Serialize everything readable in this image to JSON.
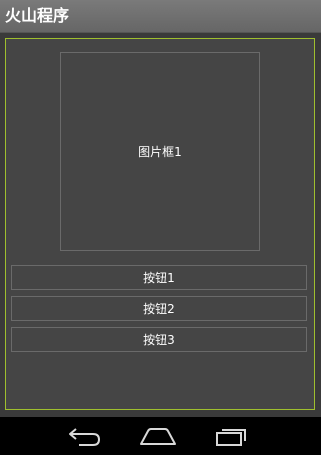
{
  "app": {
    "title": "火山程序"
  },
  "main": {
    "image_box_label": "图片框1",
    "buttons": [
      {
        "label": "按钮1"
      },
      {
        "label": "按钮2"
      },
      {
        "label": "按钮3"
      }
    ]
  },
  "nav": {
    "icons": [
      "back-icon",
      "home-icon",
      "recent-apps-icon"
    ]
  },
  "colors": {
    "title_bar": "#6f6f6f",
    "background": "#454545",
    "frame_border": "#9fbf2e",
    "nav_bar": "#000000"
  }
}
